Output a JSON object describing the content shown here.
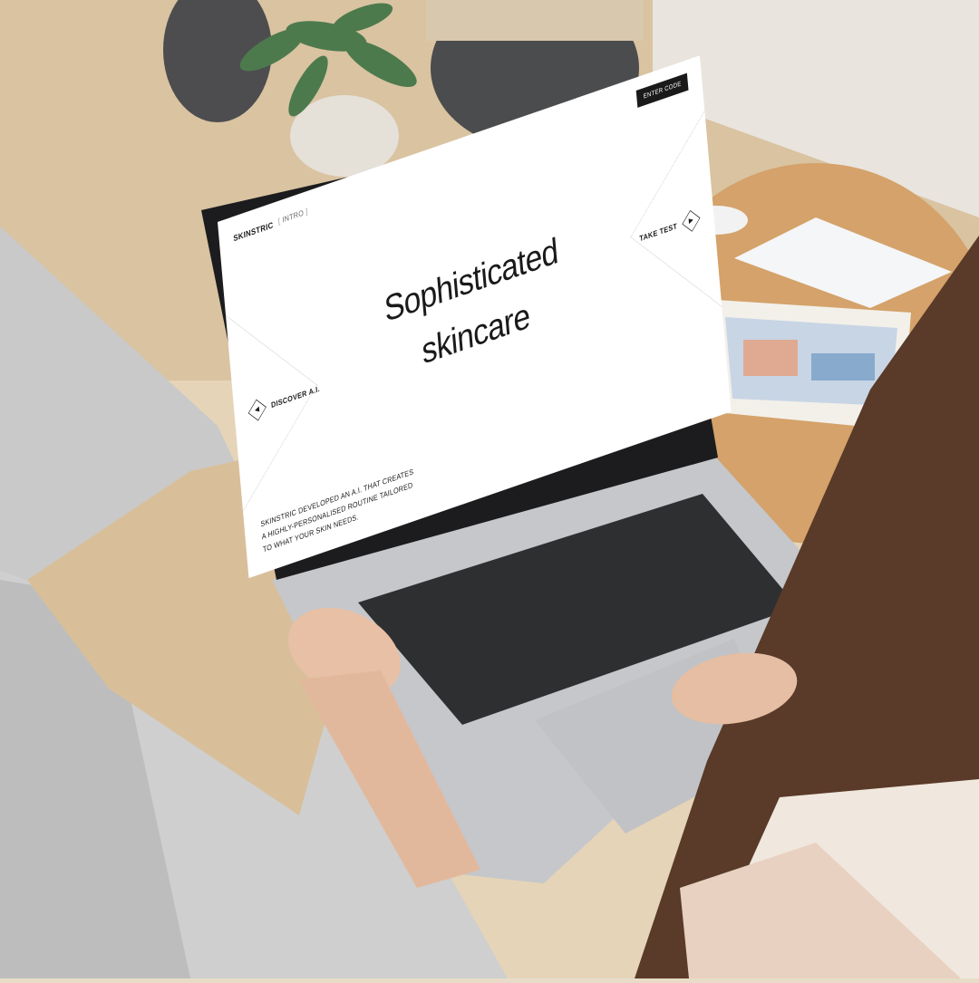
{
  "site": {
    "brand": "SKINSTRIC",
    "section": "INTRO",
    "enter_code": "ENTER CODE"
  },
  "hero": {
    "line1": "Sophisticated",
    "line2": "skincare"
  },
  "cta": {
    "left_label": "DISCOVER A.I.",
    "left_icon": "play-left-icon",
    "right_label": "TAKE TEST",
    "right_icon": "play-right-icon"
  },
  "description": "SKINSTRIC DEVELOPED AN A.I. THAT CREATES A HIGHLY-PERSONALISED ROUTINE TAILORED TO WHAT YOUR SKIN NEEDS."
}
